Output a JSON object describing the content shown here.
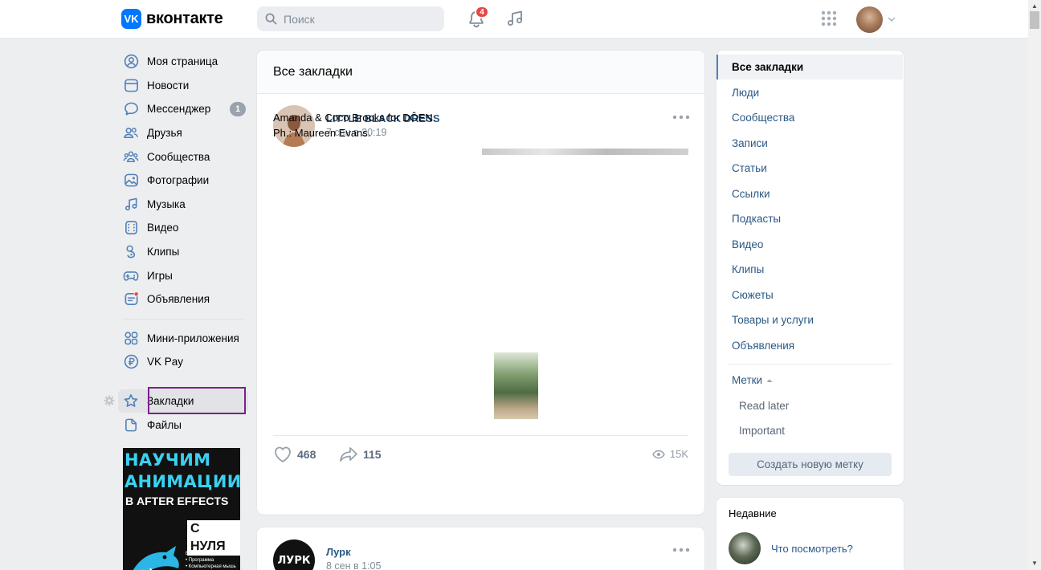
{
  "header": {
    "logo_mark": "VK",
    "logo_text": "вконтакте",
    "search_placeholder": "Поиск",
    "notifications_count": "4"
  },
  "nav": {
    "items": [
      {
        "label": "Моя страница",
        "icon": "user-circle-icon"
      },
      {
        "label": "Новости",
        "icon": "newspaper-icon"
      },
      {
        "label": "Мессенджер",
        "icon": "chat-bubble-icon",
        "count": "1"
      },
      {
        "label": "Друзья",
        "icon": "friends-icon"
      },
      {
        "label": "Сообщества",
        "icon": "communities-icon"
      },
      {
        "label": "Фотографии",
        "icon": "photo-icon"
      },
      {
        "label": "Музыка",
        "icon": "music-note-icon"
      },
      {
        "label": "Видео",
        "icon": "video-icon"
      },
      {
        "label": "Клипы",
        "icon": "clips-icon"
      },
      {
        "label": "Игры",
        "icon": "gamepad-icon"
      },
      {
        "label": "Объявления",
        "icon": "ads-icon"
      }
    ],
    "items2": [
      {
        "label": "Мини-приложения",
        "icon": "apps-icon"
      },
      {
        "label": "VK Pay",
        "icon": "ruble-icon"
      }
    ],
    "items3": [
      {
        "label": "Закладки",
        "icon": "star-icon"
      },
      {
        "label": "Файлы",
        "icon": "file-icon"
      }
    ]
  },
  "promo": {
    "line1": "НАУЧИМ",
    "line2": "АНИМАЦИИ",
    "line3": "В AFTER EFFECTS",
    "tag": "С НУЛЯ",
    "fine1": "ВАМ ПОНАДОБИТСЯ:",
    "fine2": "• Программа",
    "fine3": "• Компьютерная мышь"
  },
  "main": {
    "title": "Все закладки",
    "post1": {
      "author": "LITTLE BLACK DRESS",
      "date": "7 сен в 20:19",
      "text_line1": "Amanda & Coco Brooks for DÔEN.",
      "text_line2": "Ph.: Maureen Evans.",
      "likes": "468",
      "shares": "115",
      "views": "15K"
    },
    "post2": {
      "author": "Лурк",
      "date": "8 сен в 1:05",
      "avatar_text": "ЛУРК"
    }
  },
  "right_menu": {
    "items": [
      "Все закладки",
      "Люди",
      "Сообщества",
      "Записи",
      "Статьи",
      "Ссылки",
      "Подкасты",
      "Видео",
      "Клипы",
      "Сюжеты",
      "Товары и услуги",
      "Объявления"
    ],
    "tags_title": "Метки",
    "tags": [
      "Read later",
      "Important"
    ],
    "new_tag_button": "Создать новую метку"
  },
  "recent": {
    "title": "Недавние",
    "item": "Что посмотреть?"
  },
  "colors": {
    "accent": "#2a5885",
    "vk_blue": "#0077ff",
    "badge_red": "#e64646",
    "highlight_box": "#7b1f8a"
  }
}
